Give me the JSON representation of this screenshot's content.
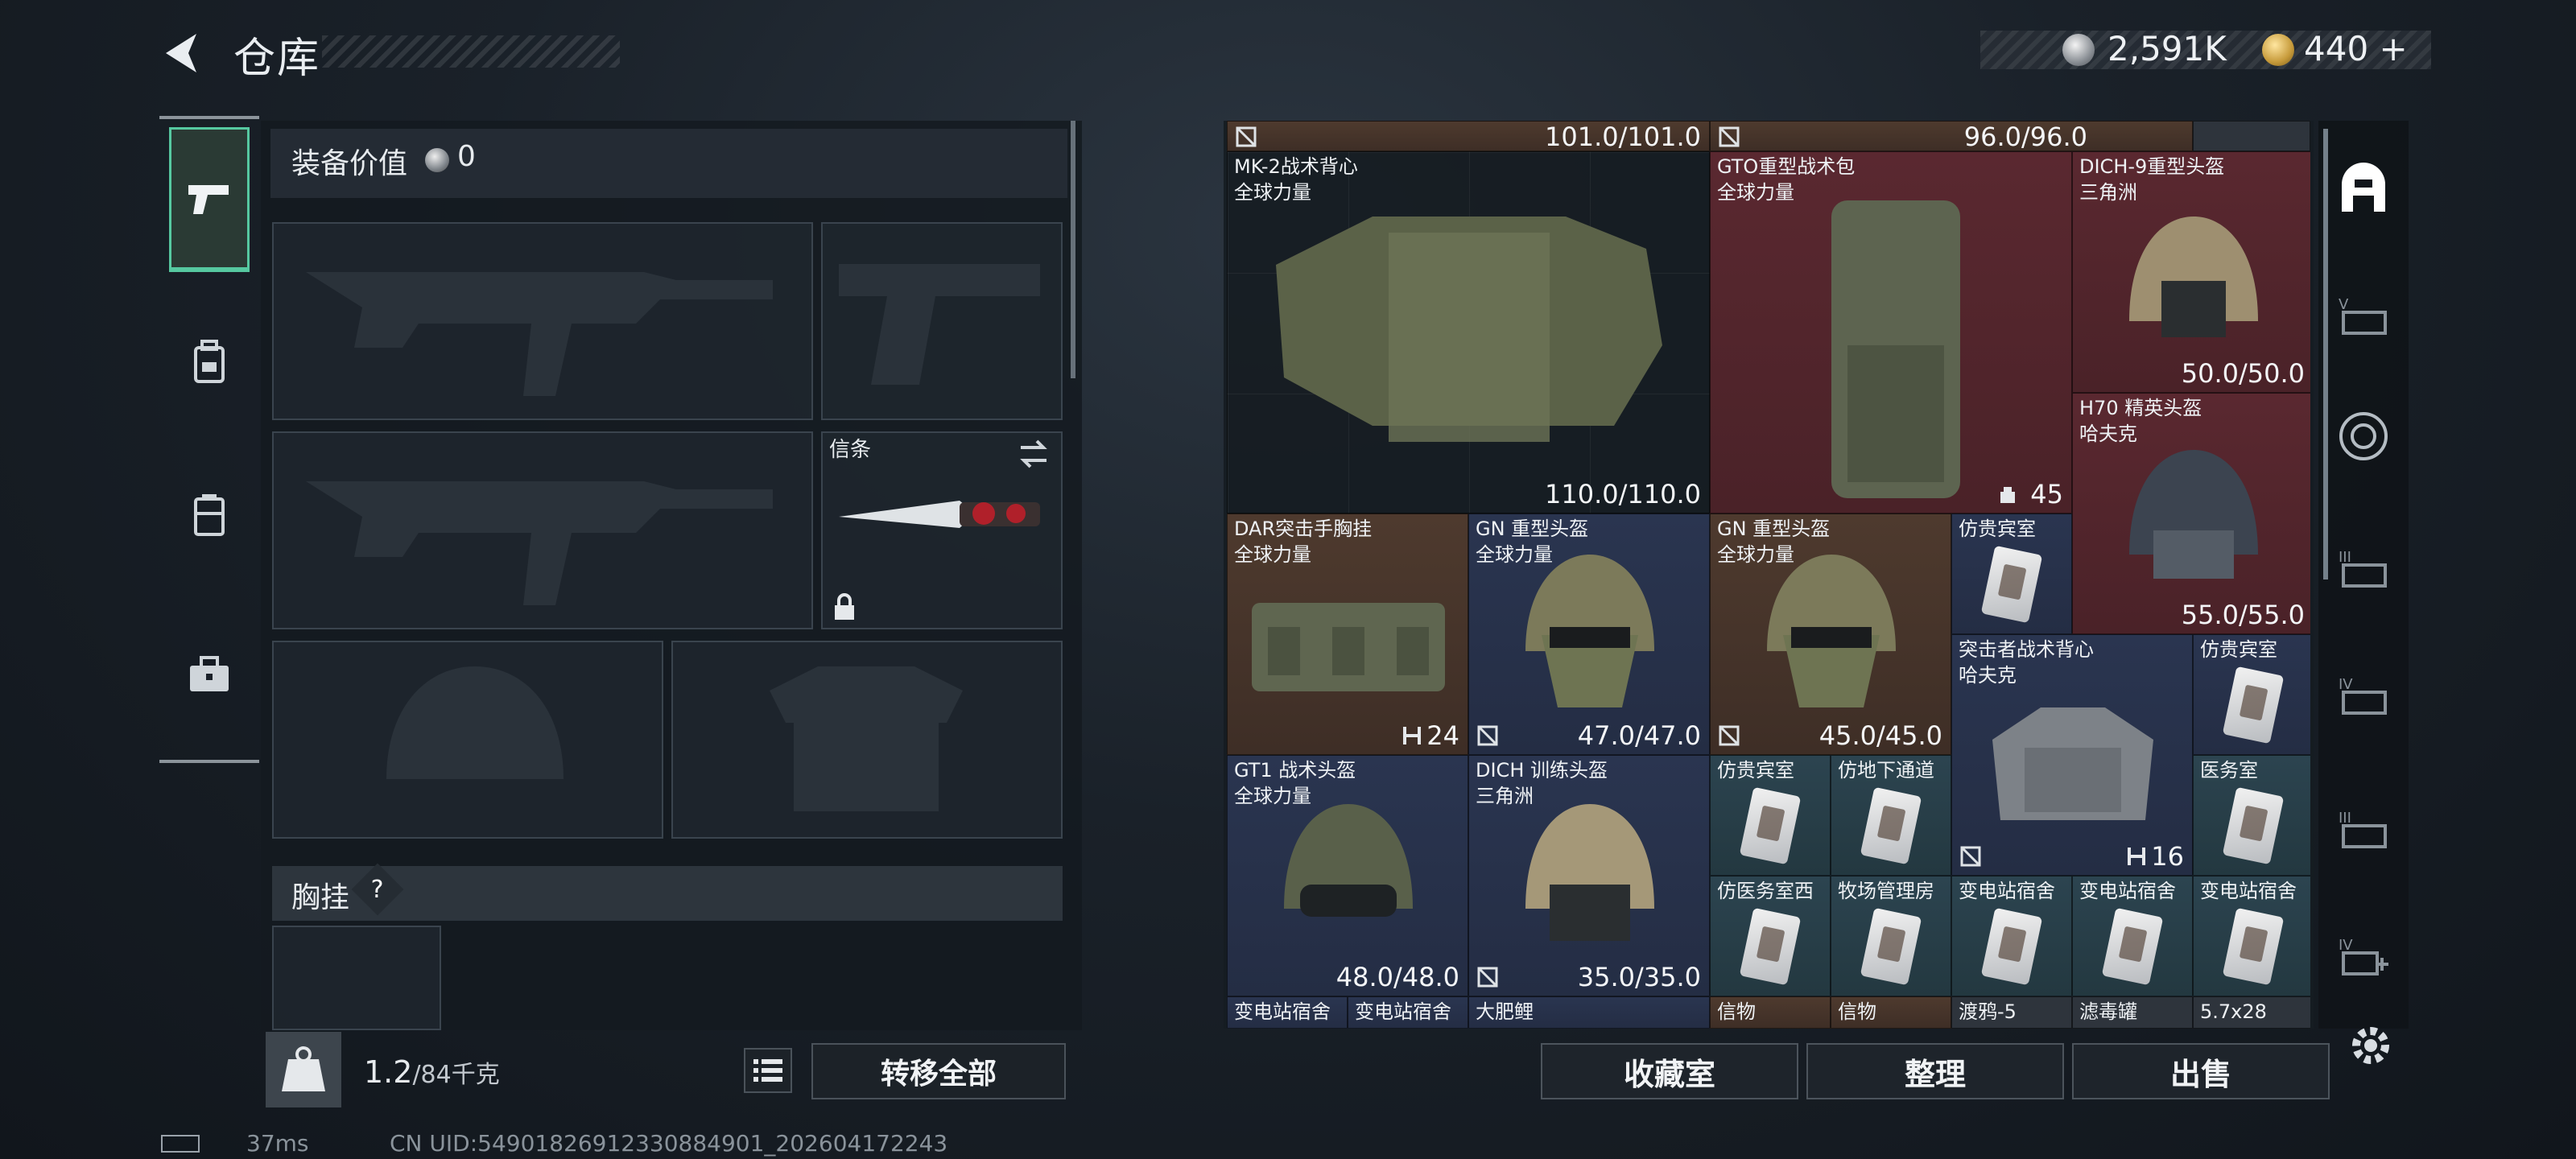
{
  "header": {
    "title": "仓库",
    "back_icon": "back-arrow-icon"
  },
  "currency": {
    "silver": "2,591K",
    "gold": "440",
    "gold_add": "+"
  },
  "left_tabs": [
    {
      "name": "weapon-tab",
      "icon": "pistol-icon",
      "selected": true
    },
    {
      "name": "backpack-tab",
      "icon": "backpack-icon"
    },
    {
      "name": "vest-tab",
      "icon": "vest-icon"
    },
    {
      "name": "case-tab",
      "icon": "briefcase-icon"
    }
  ],
  "equipment": {
    "value_label": "装备价值",
    "value": "0",
    "melee_label": "信条",
    "chest_label": "胸挂",
    "chest_help": "?"
  },
  "footer_left": {
    "weight": "1.2",
    "weight_max": "/84千克",
    "transfer_all": "转移全部"
  },
  "stash": {
    "top_values": [
      "101.0/101.0",
      "96.0/96.0"
    ],
    "items": [
      {
        "name": "MK-2战术背心",
        "sub": "全球力量",
        "value": "110.0/110.0",
        "bg": "blue"
      },
      {
        "name": "GTO重型战术包",
        "sub": "全球力量",
        "count": "45",
        "bg": "red"
      },
      {
        "name": "DICH-9重型头盔",
        "sub": "三角洲",
        "value": "50.0/50.0",
        "bg": "red"
      },
      {
        "name": "H70 精英头盔",
        "sub": "哈夫克",
        "value": "55.0/55.0",
        "bg": "red"
      },
      {
        "name": "DAR突击手胸挂",
        "sub": "全球力量",
        "count": "24",
        "bg": "brown"
      },
      {
        "name": "GN 重型头盔",
        "sub": "全球力量",
        "value": "47.0/47.0",
        "bg": "blue"
      },
      {
        "name": "GN 重型头盔",
        "sub": "全球力量",
        "value": "45.0/45.0",
        "bg": "brown"
      },
      {
        "name": "仿贵宾室",
        "bg": "blue"
      },
      {
        "name": "突击者战术背心",
        "sub": "哈夫克",
        "count": "16",
        "bg": "blue"
      },
      {
        "name": "仿贵宾室",
        "bg": "blue"
      },
      {
        "name": "GT1 战术头盔",
        "sub": "全球力量",
        "value": "48.0/48.0",
        "bg": "blue"
      },
      {
        "name": "DICH 训练头盔",
        "sub": "三角洲",
        "value": "35.0/35.0",
        "bg": "blue"
      },
      {
        "name": "仿贵宾室",
        "bg": "teal"
      },
      {
        "name": "仿地下通道",
        "bg": "teal"
      },
      {
        "name": "医务室",
        "bg": "teal"
      },
      {
        "name": "仿医务室西",
        "bg": "teal"
      },
      {
        "name": "牧场管理房",
        "bg": "teal"
      },
      {
        "name": "变电站宿舍",
        "bg": "teal"
      },
      {
        "name": "变电站宿舍",
        "bg": "teal"
      },
      {
        "name": "变电站宿舍",
        "bg": "teal"
      }
    ],
    "bottom_row": [
      "变电站宿舍",
      "变电站宿舍",
      "大肥鲤",
      "信物",
      "信物",
      "渡鸦-5",
      "滤毒罐",
      "5.7x28"
    ]
  },
  "stash_buttons": {
    "collect": "收藏室",
    "sort": "整理",
    "sell": "出售"
  },
  "right_tabs": [
    "home-icon",
    "tier-v-icon",
    "target-icon",
    "tier-iii-icon",
    "tier-iv-icon",
    "tier-iii-2-icon",
    "tier-iv-add-icon"
  ],
  "status": {
    "ping": "37ms",
    "uid": "CN UID:54901826912330884901_202604172243"
  },
  "colors": {
    "accent": "#56c8a0",
    "red_item": "#5a2830",
    "blue_item": "#2a3550"
  }
}
